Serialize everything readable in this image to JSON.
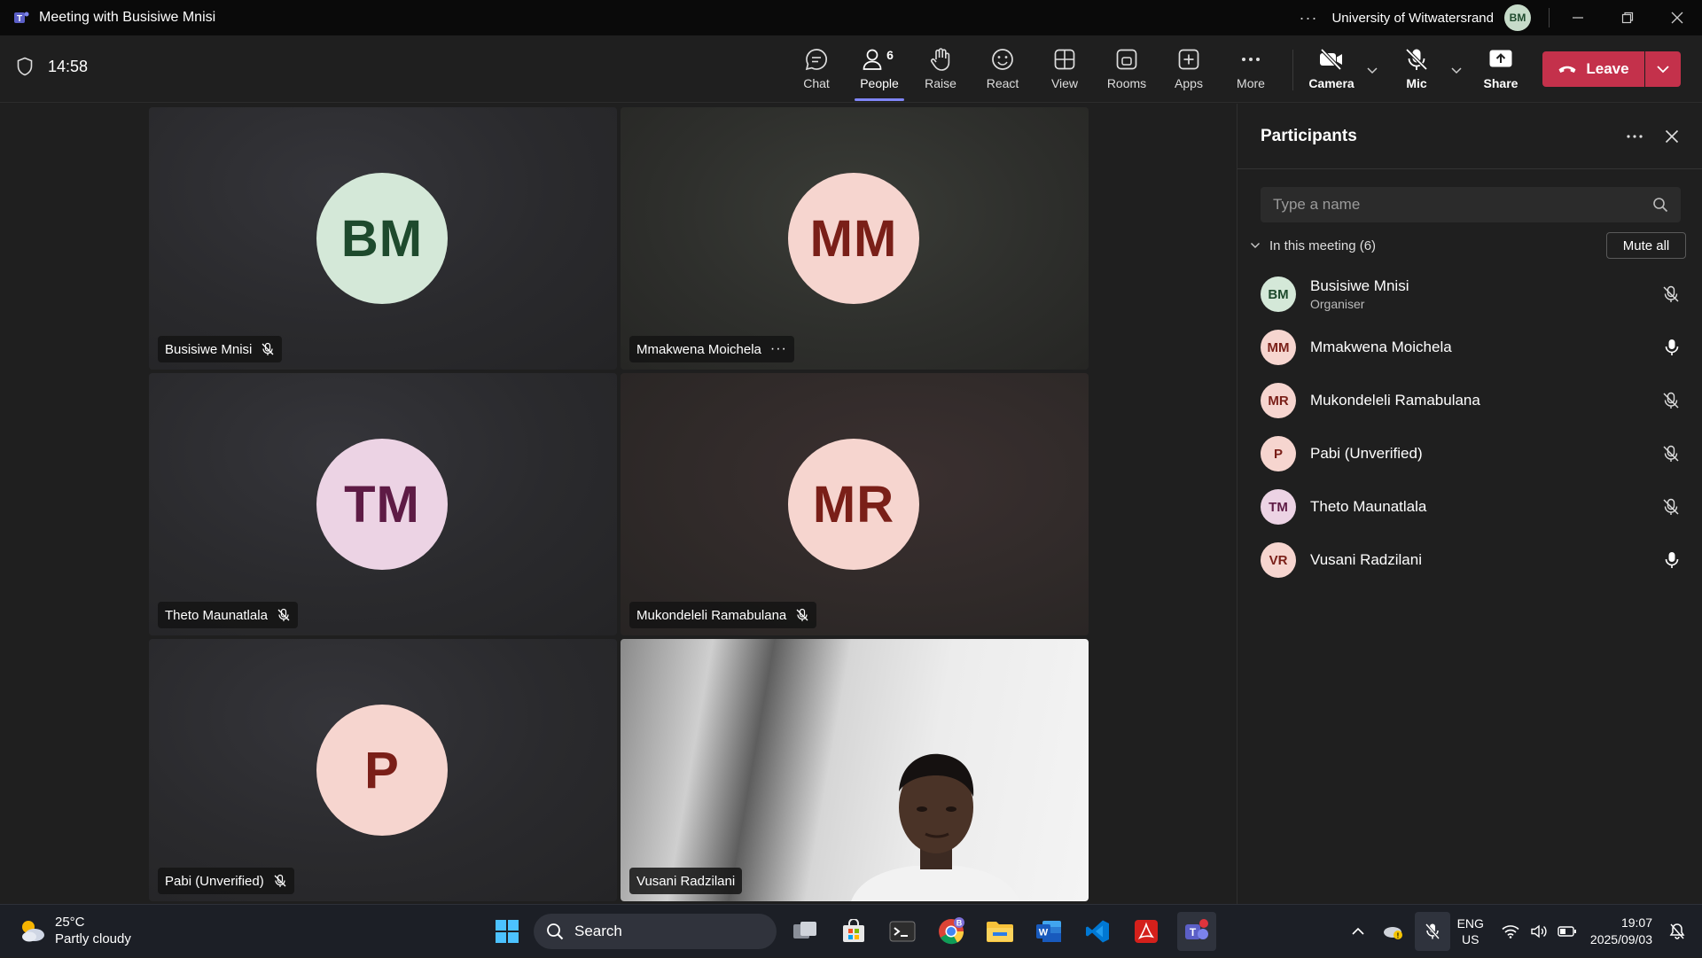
{
  "window": {
    "title": "Meeting with Busisiwe Mnisi",
    "org": "University of Witwatersrand",
    "user_initials": "BM"
  },
  "toolbar": {
    "timer": "14:58",
    "chat": "Chat",
    "people": "People",
    "people_count": "6",
    "raise": "Raise",
    "react": "React",
    "view": "View",
    "rooms": "Rooms",
    "apps": "Apps",
    "more": "More",
    "camera": "Camera",
    "mic": "Mic",
    "share": "Share",
    "leave": "Leave"
  },
  "tiles": [
    {
      "initials": "BM",
      "name": "Busisiwe Mnisi",
      "bg": "#d4e8d8",
      "fg": "#1e4a2d"
    },
    {
      "initials": "MM",
      "name": "Mmakwena Moichela",
      "bg": "#f6d5cf",
      "fg": "#7a1f18"
    },
    {
      "initials": "TM",
      "name": "Theto Maunatlala",
      "bg": "#ecd3e4",
      "fg": "#5e1b45"
    },
    {
      "initials": "MR",
      "name": "Mukondeleli Ramabulana",
      "bg": "#f6d5cf",
      "fg": "#7a1f18"
    },
    {
      "initials": "P",
      "name": "Pabi (Unverified)",
      "bg": "#f6d5cf",
      "fg": "#7a1f18"
    },
    {
      "name": "Vusani Radzilani"
    }
  ],
  "panel": {
    "title": "Participants",
    "search_placeholder": "Type a name",
    "section": "In this meeting (6)",
    "mute_all": "Mute all",
    "participants": [
      {
        "initials": "BM",
        "name": "Busisiwe Mnisi",
        "role": "Organiser",
        "muted": true,
        "bg": "#d4e8d8",
        "fg": "#1e4a2d"
      },
      {
        "initials": "MM",
        "name": "Mmakwena Moichela",
        "role": "",
        "muted": false,
        "bg": "#f6d5cf",
        "fg": "#7a1f18"
      },
      {
        "initials": "MR",
        "name": "Mukondeleli Ramabulana",
        "role": "",
        "muted": true,
        "bg": "#f6d5cf",
        "fg": "#7a1f18"
      },
      {
        "initials": "P",
        "name": "Pabi (Unverified)",
        "role": "",
        "muted": true,
        "bg": "#f6d5cf",
        "fg": "#7a1f18"
      },
      {
        "initials": "TM",
        "name": "Theto Maunatlala",
        "role": "",
        "muted": true,
        "bg": "#ecd3e4",
        "fg": "#5e1b45"
      },
      {
        "initials": "VR",
        "name": "Vusani Radzilani",
        "role": "",
        "muted": false,
        "bg": "#f6d5cf",
        "fg": "#7a1f18"
      }
    ]
  },
  "taskbar": {
    "temperature": "25°C",
    "weather": "Partly cloudy",
    "search": "Search",
    "lang_top": "ENG",
    "lang_bottom": "US",
    "time": "19:07",
    "date": "2025/09/03",
    "chrome_badge": "B"
  },
  "colors": {
    "accent": "#7f85f5",
    "leave": "#c4314b"
  }
}
